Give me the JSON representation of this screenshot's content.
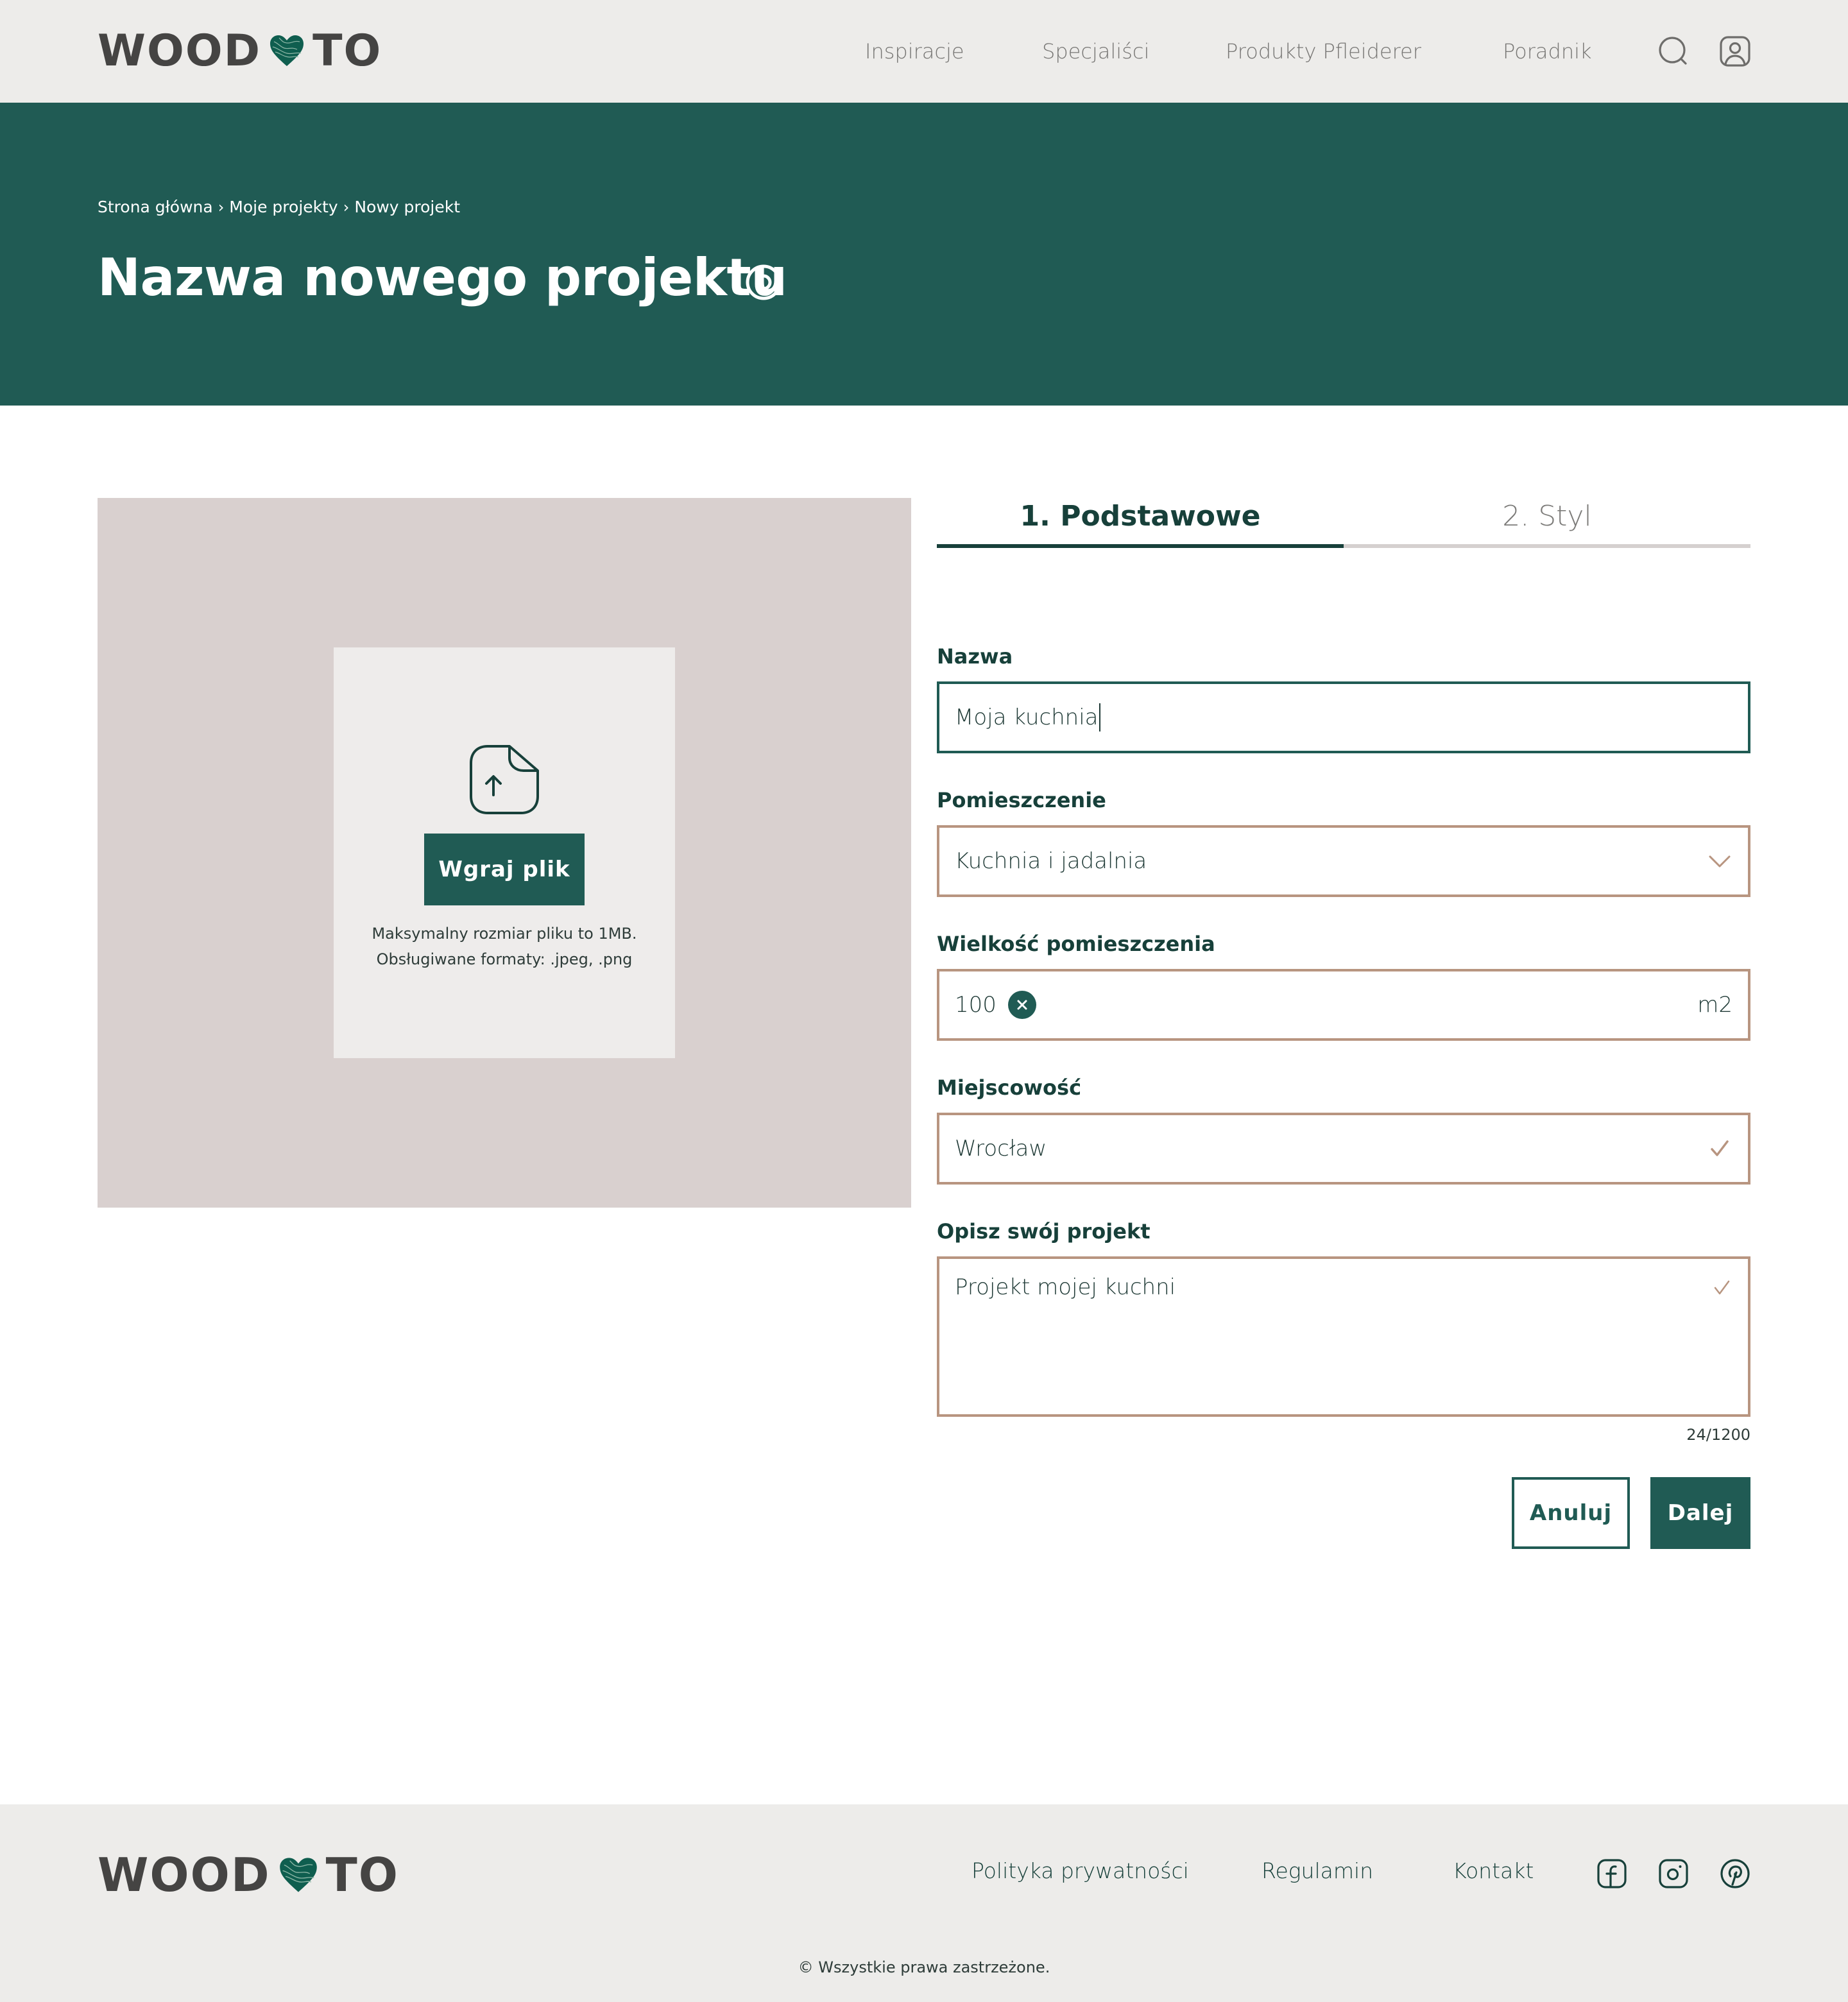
{
  "brand": {
    "logo_left": "WOOD",
    "logo_right": "TO",
    "accent_color": "#205b54",
    "heart_color": "#0f5e4f",
    "field_border_color": "#b89580"
  },
  "header": {
    "nav": [
      {
        "label": "Inspiracje"
      },
      {
        "label": "Specjaliści"
      },
      {
        "label": "Produkty Pfleiderer"
      },
      {
        "label": "Poradnik"
      }
    ],
    "icons": [
      "search-icon",
      "user-profile-icon"
    ]
  },
  "hero": {
    "breadcrumb": [
      {
        "label": "Strona główna"
      },
      {
        "label": "Moje projekty"
      },
      {
        "label": "Nowy projekt"
      }
    ],
    "separator": "›",
    "title": "Nazwa nowego projektu",
    "title_icon": "eye-icon"
  },
  "upload": {
    "icon": "file-upload-icon",
    "button_label": "Wgraj plik",
    "hint_line1": "Maksymalny rozmiar pliku to 1MB.",
    "hint_line2": "Obsługiwane formaty: .jpeg, .png"
  },
  "steps": [
    {
      "label": "1. Podstawowe",
      "active": true
    },
    {
      "label": "2. Styl",
      "active": false
    }
  ],
  "form": {
    "name": {
      "label": "Nazwa",
      "value": "Moja kuchnia",
      "focused": true
    },
    "room": {
      "label": "Pomieszczenie",
      "value": "Kuchnia i jadalnia"
    },
    "size": {
      "label": "Wielkość pomieszczenia",
      "value": "100",
      "unit": "m2"
    },
    "city": {
      "label": "Miejscowość",
      "value": "Wrocław",
      "valid": true
    },
    "description": {
      "label": "Opisz swój projekt",
      "value": "Projekt mojej kuchni",
      "counter": "24/1200",
      "valid": true
    },
    "cancel_label": "Anuluj",
    "next_label": "Dalej"
  },
  "footer": {
    "links": [
      {
        "label": "Polityka prywatności"
      },
      {
        "label": "Regulamin"
      },
      {
        "label": "Kontakt"
      }
    ],
    "social": [
      "facebook-icon",
      "instagram-icon",
      "pinterest-icon"
    ],
    "copyright": "© Wszystkie prawa zastrzeżone."
  }
}
